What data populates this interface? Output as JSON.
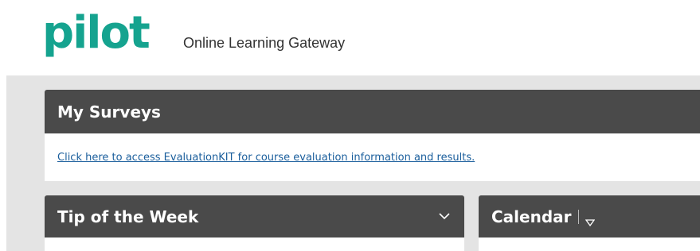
{
  "header": {
    "logo_text": "pilot",
    "tagline": "Online Learning Gateway"
  },
  "surveys": {
    "title": "My Surveys",
    "link_text": "Click here to access EvaluationKIT for course evaluation information and results."
  },
  "tip": {
    "title": "Tip of the Week",
    "icon": "chevron-down-icon"
  },
  "calendar": {
    "title": "Calendar",
    "icon": "triangle-down-icon"
  },
  "colors": {
    "brand": "#15a38f",
    "module_header": "#4a4a4a",
    "background": "#e4e4e4",
    "link": "#1a5e9c"
  }
}
